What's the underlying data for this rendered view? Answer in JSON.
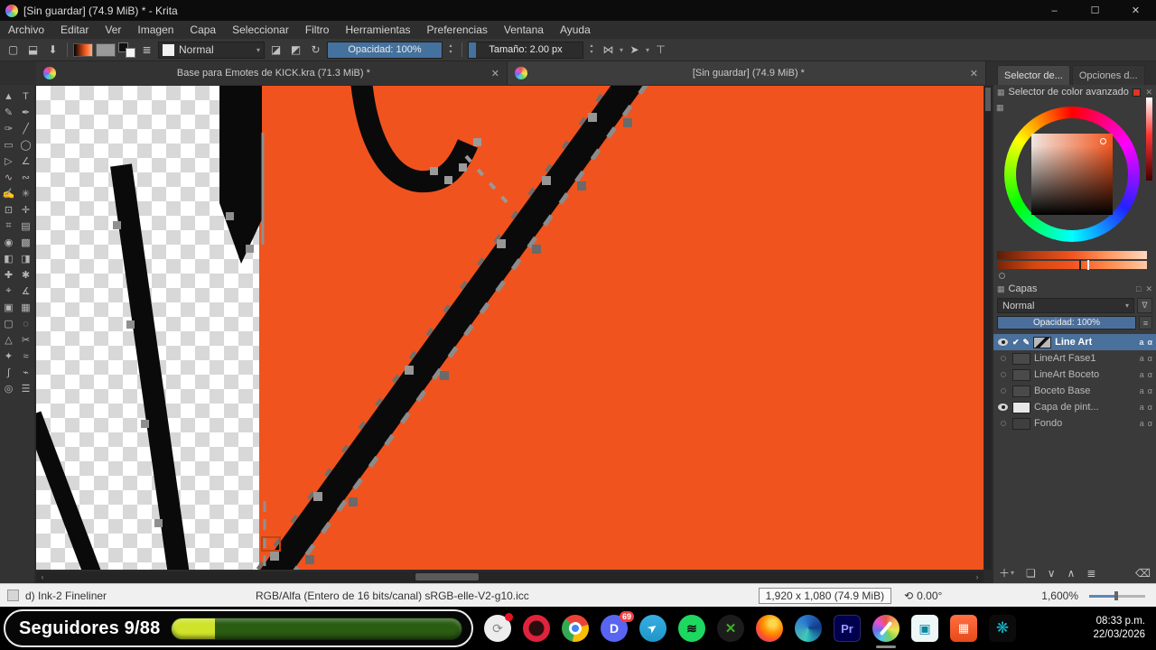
{
  "window": {
    "title": "[Sin guardar]  (74.9 MiB) * - Krita",
    "minimize": "–",
    "maximize": "☐",
    "close": "✕"
  },
  "menu": {
    "items": [
      "Archivo",
      "Editar",
      "Ver",
      "Imagen",
      "Capa",
      "Seleccionar",
      "Filtro",
      "Herramientas",
      "Preferencias",
      "Ventana",
      "Ayuda"
    ]
  },
  "toolbar": {
    "blend_mode": "Normal",
    "opacity": "Opacidad: 100%",
    "size": "Tamaño: 2.00 px"
  },
  "doc_tabs": [
    {
      "label": "Base para Emotes de KICK.kra (71.3 MiB) *"
    },
    {
      "label": "[Sin guardar]  (74.9 MiB) *"
    }
  ],
  "panel_tabs": [
    {
      "label": "Selector de..."
    },
    {
      "label": "Opciones d..."
    }
  ],
  "color_docker": {
    "title": "Selector de color avanzado"
  },
  "layers_docker": {
    "title": "Capas",
    "blend_mode": "Normal",
    "opacity_label": "Opacidad:  100%",
    "lock": "a",
    "alpha": "α",
    "rows": [
      {
        "name": "Line Art"
      },
      {
        "name": "LineArt Fase1"
      },
      {
        "name": "LineArt Boceto"
      },
      {
        "name": "Boceto Base"
      },
      {
        "name": "Capa de pint..."
      },
      {
        "name": "Fondo"
      }
    ],
    "toolbar": {
      "add": "＋",
      "duplicate": "❏",
      "down": "∨",
      "up": "∧",
      "props": "≣",
      "del": "⌫"
    }
  },
  "statusbar": {
    "preset": "d) Ink-2 Fineliner",
    "profile": "RGB/Alfa (Entero de 16 bits/canal)  sRGB-elle-V2-g10.icc",
    "dimensions": "1,920 x 1,080 (74.9 MiB)",
    "angle": "0.00°",
    "zoom": "1,600%"
  },
  "overlay": {
    "followers_label": "Seguidores 9/88"
  },
  "taskbar": {
    "discord_badge": "69",
    "premiere_label": "Pr",
    "time": "08:33 p.m.",
    "date": "22/03/2026"
  },
  "icons": {
    "check": "✔",
    "pen": "✎",
    "close": "✕",
    "caret": "▾",
    "up": "▴",
    "down": "▾",
    "new": "▢",
    "open": "⬓",
    "save": "⬇",
    "reload": "↻",
    "eraser": "◪",
    "alpha_lock": "◩",
    "brush_list": "≣",
    "mirror_h": "⋈",
    "mirror_v": "➤",
    "wrap": "⊤",
    "left": "‹",
    "right": "›",
    "angle": "⟲",
    "grid": "▦",
    "float": "□",
    "funnel": "∇",
    "menu": "≡",
    "rec": "⟳",
    "discord": "D",
    "telegram": "➤",
    "spotify": "≋",
    "xbox": "✕",
    "pc": "▣",
    "cal": "▦",
    "sharex": "❋"
  },
  "toolbox": {
    "tools": [
      {
        "name": "shape-select",
        "glyph": "▲"
      },
      {
        "name": "text",
        "glyph": "T"
      },
      {
        "name": "edit-shapes",
        "glyph": "✎"
      },
      {
        "name": "calligraphy",
        "glyph": "✒"
      },
      {
        "name": "freehand-brush",
        "glyph": "✑"
      },
      {
        "name": "line",
        "glyph": "╱"
      },
      {
        "name": "rectangle",
        "glyph": "▭"
      },
      {
        "name": "ellipse",
        "glyph": "◯"
      },
      {
        "name": "polygon",
        "glyph": "▷"
      },
      {
        "name": "polyline",
        "glyph": "∠"
      },
      {
        "name": "bezier",
        "glyph": "∿"
      },
      {
        "name": "freehand-path",
        "glyph": "∾"
      },
      {
        "name": "dynamic-brush",
        "glyph": "✍"
      },
      {
        "name": "multibrush",
        "glyph": "✳"
      },
      {
        "name": "transform",
        "glyph": "⊡"
      },
      {
        "name": "move",
        "glyph": "✛"
      },
      {
        "name": "crop",
        "glyph": "⌗"
      },
      {
        "name": "gradient",
        "glyph": "▤"
      },
      {
        "name": "color-sampler",
        "glyph": "◉"
      },
      {
        "name": "pattern-edit",
        "glyph": "▩"
      },
      {
        "name": "fill",
        "glyph": "◧"
      },
      {
        "name": "enclose-fill",
        "glyph": "◨"
      },
      {
        "name": "smart-patch",
        "glyph": "✚"
      },
      {
        "name": "colorize-mask",
        "glyph": "✱"
      },
      {
        "name": "assistants",
        "glyph": "⌖"
      },
      {
        "name": "measure",
        "glyph": "∡"
      },
      {
        "name": "reference-images",
        "glyph": "▣"
      },
      {
        "name": "patch",
        "glyph": "▦"
      },
      {
        "name": "rect-select",
        "glyph": "▢"
      },
      {
        "name": "ellipse-select",
        "glyph": "◌"
      },
      {
        "name": "poly-select",
        "glyph": "△"
      },
      {
        "name": "freehand-select",
        "glyph": "✂"
      },
      {
        "name": "contiguous-select",
        "glyph": "✦"
      },
      {
        "name": "similar-select",
        "glyph": "≈"
      },
      {
        "name": "bezier-select",
        "glyph": "∫"
      },
      {
        "name": "magnetic-select",
        "glyph": "⌁"
      },
      {
        "name": "zoom",
        "glyph": "◎"
      },
      {
        "name": "pan",
        "glyph": "☰"
      }
    ]
  }
}
